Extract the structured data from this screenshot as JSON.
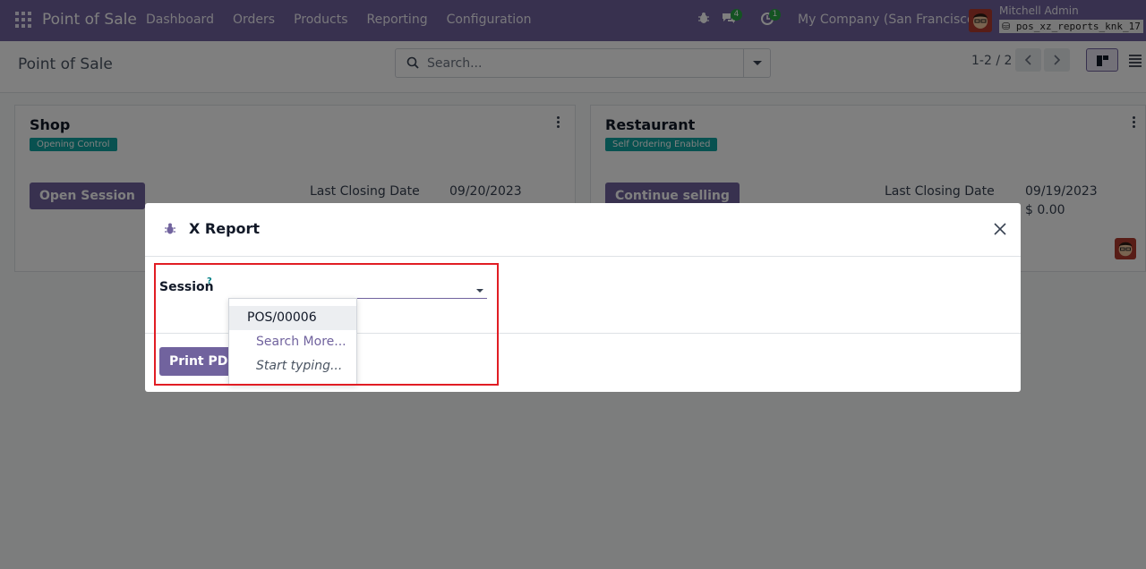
{
  "navbar": {
    "brand": "Point of Sale",
    "menu": [
      "Dashboard",
      "Orders",
      "Products",
      "Reporting",
      "Configuration"
    ],
    "messages_count": "4",
    "activity_count": "1",
    "company": "My Company (San Francisco)",
    "user": "Mitchell Admin",
    "database": "pos_xz_reports_knk_17"
  },
  "control": {
    "title": "Point of Sale",
    "search_placeholder": "Search...",
    "pager": "1-2 / 2"
  },
  "cards": [
    {
      "title": "Shop",
      "badge": "Opening Control",
      "button": "Open Session",
      "closing_label": "Last Closing Date",
      "closing_date": "09/20/2023"
    },
    {
      "title": "Restaurant",
      "badge": "Self Ordering Enabled",
      "button": "Continue selling",
      "closing_label": "Last Closing Date",
      "closing_date": "09/19/2023",
      "amount": "$ 0.00"
    }
  ],
  "modal": {
    "title": "X Report",
    "session_label": "Session",
    "session_help": "?",
    "print_button": "Print PDF",
    "dropdown": {
      "options": [
        "POS/00006"
      ],
      "search_more": "Search More...",
      "start_typing": "Start typing..."
    }
  },
  "colors": {
    "brand": "#71639e",
    "badge": "#11a3a0",
    "highlight": "#e11d24"
  }
}
